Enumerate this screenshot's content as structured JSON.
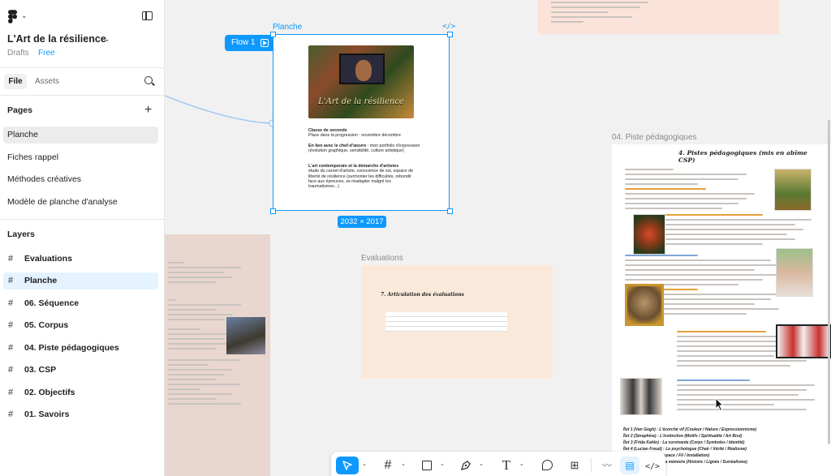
{
  "app": {
    "file_title": "L'Art de la résilience",
    "location": "Drafts",
    "plan": "Free"
  },
  "tabs": {
    "file": "File",
    "assets": "Assets"
  },
  "pages": {
    "title": "Pages",
    "items": [
      {
        "label": "Planche",
        "active": true
      },
      {
        "label": "Fiches rappel"
      },
      {
        "label": "Méthodes créatives"
      },
      {
        "label": "Modèle de planche d'analyse"
      }
    ]
  },
  "layers": {
    "title": "Layers",
    "items": [
      {
        "label": "Evaluations"
      },
      {
        "label": "Planche",
        "active": true
      },
      {
        "label": "06. Séquence"
      },
      {
        "label": "05. Corpus"
      },
      {
        "label": "04. Piste pédagogiques"
      },
      {
        "label": "03. CSP"
      },
      {
        "label": "02. Objectifs"
      },
      {
        "label": "01. Savoirs"
      }
    ]
  },
  "canvas": {
    "planche_label": "Planche",
    "flow_label": "Flow 1",
    "size_badge": "2032 × 2017",
    "planche_image_title": "L'Art de la résilience",
    "planche_text": [
      {
        "bold": "Classe de seconde",
        "text": "Place dans la progression : novembre décembre"
      },
      {
        "bold": "En lien avec le chef-d'œuvre",
        "text": " : mon portfolio d'expression (évolution graphique, sensibilité, culture artistique)"
      },
      {
        "bold": "L'art contemporain et la démarche d'artistes",
        "text": "étude du carnet d'artiste, conscience de soi, espace de liberté de résilience (surmonter les difficultés, rebondir face aux épreuves, se réadapter malgré les traumatismes...)"
      }
    ],
    "piste_label": "04. Piste pédagogiques",
    "piste_title": "4. Pistes pédagogiques (mis en abîme CSP)",
    "piste_footer": [
      "Îlot 1 (Van Gogh) : L'écorché vif (Couleur / Nature / Expressionnisme)",
      "Îlot 2 (Séraphine) : L'instinctive (Motifs / Spiritualité / Art Brut)",
      "Îlot 3 (Frida Kahlo) : La survivante (Corps / Symboles / Identité)",
      "Îlot 4 (Lucian Freud) : Le psychologue (Chair / Vérité / Réalisme)",
      "Îlot 5 : La tisseuse (Espace / Fil / Installation)",
      "Îlot 6 : Le gardien de la mémoire (Histoire / Lignée / Surréalisme)"
    ],
    "eval_label": "Evaluations",
    "eval_title": "7. Articulation des évaluations"
  },
  "toolbar": {
    "tools": [
      "move-tool",
      "frame-tool",
      "shape-tool",
      "pen-tool",
      "text-tool",
      "comment-tool",
      "actions-tool",
      "draw-mode",
      "design-mode",
      "dev-mode"
    ]
  },
  "colors": {
    "accent": "#0d99ff",
    "selected_layer_bg": "#e5f2ff",
    "eval_frame_bg": "#fae9da",
    "left_frame_bg": "#e8d6cf"
  }
}
